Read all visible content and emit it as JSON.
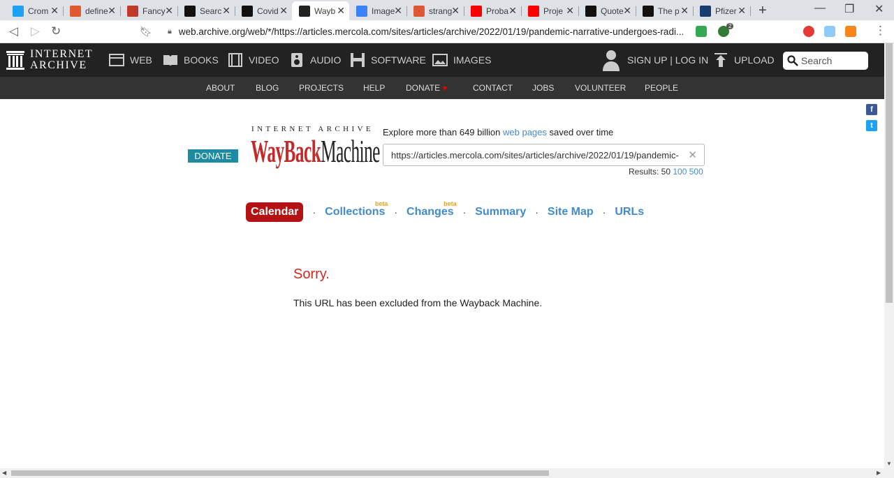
{
  "browser": {
    "tabs": [
      {
        "label": "Crom",
        "icon": "twitter-icon",
        "color": "#1da1f2"
      },
      {
        "label": "define",
        "icon": "duckduckgo-icon",
        "color": "#de5833"
      },
      {
        "label": "Fancy",
        "icon": "document-icon",
        "color": "#c0392b"
      },
      {
        "label": "Searc",
        "icon": "site-icon",
        "color": "#111111"
      },
      {
        "label": "Covid",
        "icon": "site-icon",
        "color": "#111111"
      },
      {
        "label": "Wayb",
        "icon": "internet-archive-icon",
        "color": "#222222"
      },
      {
        "label": "Image",
        "icon": "pinterest-icon",
        "color": "#3b82f6"
      },
      {
        "label": "strang",
        "icon": "duckduckgo-icon",
        "color": "#de5833"
      },
      {
        "label": "Proba",
        "icon": "youtube-icon",
        "color": "#ff0000"
      },
      {
        "label": "Proje",
        "icon": "youtube-icon",
        "color": "#ff0000"
      },
      {
        "label": "Quote",
        "icon": "site-icon",
        "color": "#111111"
      },
      {
        "label": "The p",
        "icon": "site-icon",
        "color": "#111111"
      },
      {
        "label": "Pfizer",
        "icon": "ft-icon",
        "color": "#1a3b6e"
      }
    ],
    "url": "web.archive.org/web/*/https://articles.mercola.com/sites/articles/archive/2022/01/19/pandemic-narrative-undergoes-radi...",
    "extension_badge": "2"
  },
  "ia": {
    "logo_line1": "INTERNET",
    "logo_line2": "ARCHIVE",
    "nav": [
      "WEB",
      "BOOKS",
      "VIDEO",
      "AUDIO",
      "SOFTWARE",
      "IMAGES"
    ],
    "signup": "SIGN UP | LOG IN",
    "upload": "UPLOAD",
    "search_placeholder": "Search",
    "subnav": [
      "ABOUT",
      "BLOG",
      "PROJECTS",
      "HELP",
      "DONATE",
      "CONTACT",
      "JOBS",
      "VOLUNTEER",
      "PEOPLE"
    ]
  },
  "wayback": {
    "donate": "DONATE",
    "logo_top": "INTERNET ARCHIVE",
    "logo_way": "WayBack",
    "logo_machine": "Machine",
    "explore_prefix": "Explore more than 649 billion ",
    "explore_link": "web pages",
    "explore_suffix": " saved over time",
    "url_value": "https://articles.mercola.com/sites/articles/archive/2022/01/19/pandemic-",
    "results_label": "Results: 50 ",
    "results_100": "100",
    "results_500": "500",
    "tabs": {
      "calendar": "Calendar",
      "collections": "Collections",
      "changes": "Changes",
      "summary": "Summary",
      "sitemap": "Site Map",
      "urls": "URLs",
      "beta": "beta"
    },
    "sorry": "Sorry.",
    "message": "This URL has been excluded from the Wayback Machine."
  }
}
